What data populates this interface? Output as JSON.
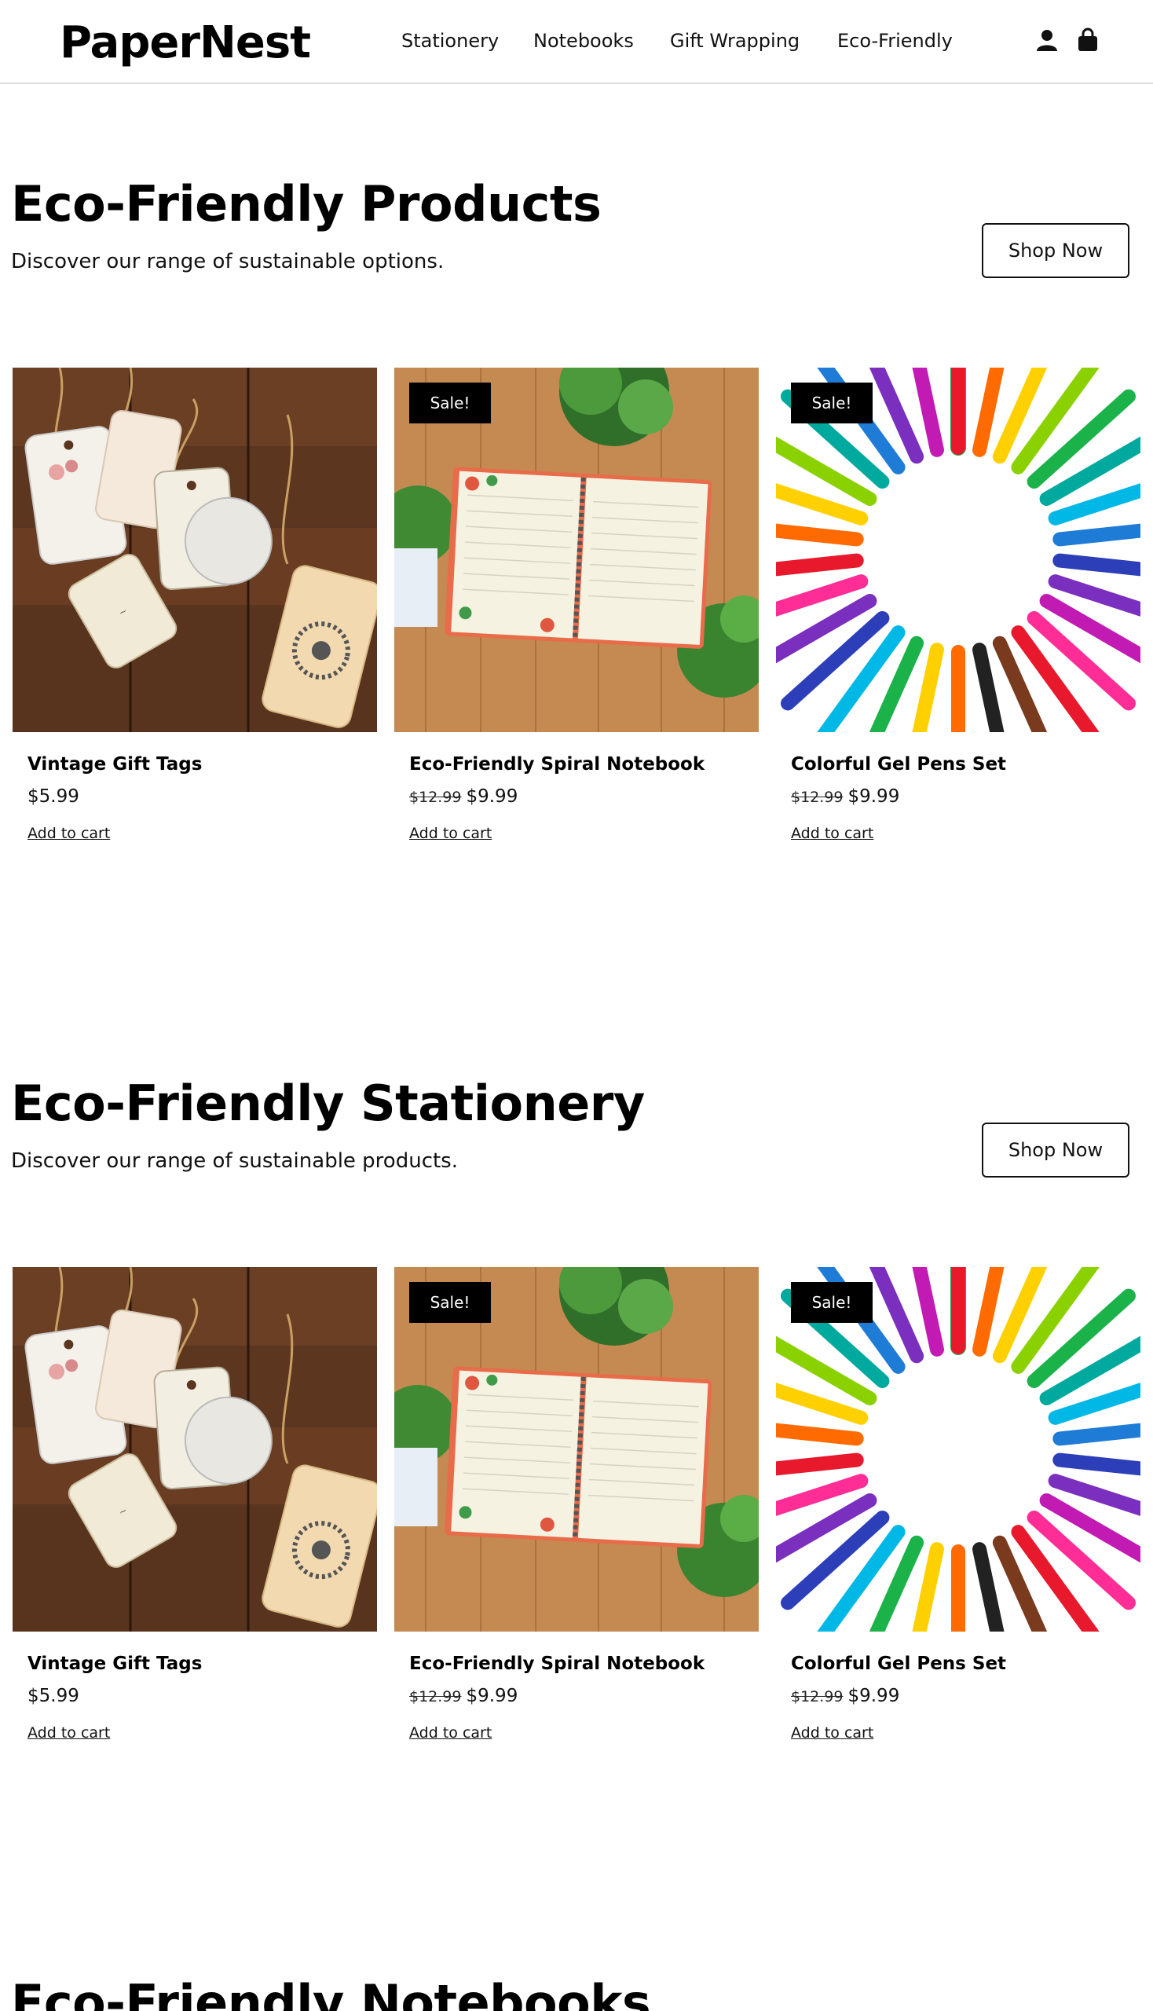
{
  "brand": {
    "logo": "PaperNest"
  },
  "nav": {
    "items": [
      {
        "label": "Stationery"
      },
      {
        "label": "Notebooks"
      },
      {
        "label": "Gift Wrapping"
      },
      {
        "label": "Eco-Friendly"
      }
    ],
    "icons": [
      "user-icon",
      "shopping-bag-icon"
    ]
  },
  "sections": [
    {
      "title": "Eco-Friendly Products",
      "subtitle": "Discover our range of sustainable options.",
      "button": "Shop Now",
      "products": [
        {
          "name": "Vintage Gift Tags",
          "price": "$5.99",
          "old_price": "",
          "sale": "",
          "cart": "Add to cart"
        },
        {
          "name": "Eco-Friendly Spiral Notebook",
          "price": "$9.99",
          "old_price": "$12.99",
          "sale": "Sale!",
          "cart": "Add to cart"
        },
        {
          "name": "Colorful Gel Pens Set",
          "price": "$9.99",
          "old_price": "$12.99",
          "sale": "Sale!",
          "cart": "Add to cart"
        }
      ]
    },
    {
      "title": "Eco-Friendly Stationery",
      "subtitle": "Discover our range of sustainable products.",
      "button": "Shop Now",
      "products": [
        {
          "name": "Vintage Gift Tags",
          "price": "$5.99",
          "old_price": "",
          "sale": "",
          "cart": "Add to cart"
        },
        {
          "name": "Eco-Friendly Spiral Notebook",
          "price": "$9.99",
          "old_price": "$12.99",
          "sale": "Sale!",
          "cart": "Add to cart"
        },
        {
          "name": "Colorful Gel Pens Set",
          "price": "$9.99",
          "old_price": "$12.99",
          "sale": "Sale!",
          "cart": "Add to cart"
        }
      ]
    },
    {
      "title": "Eco-Friendly Notebooks"
    }
  ],
  "colors": {
    "text": "#111111",
    "badge": "#000000",
    "border": "#dcdcdc",
    "wood_dark": "#5a3520",
    "wood_light": "#c48a52"
  }
}
